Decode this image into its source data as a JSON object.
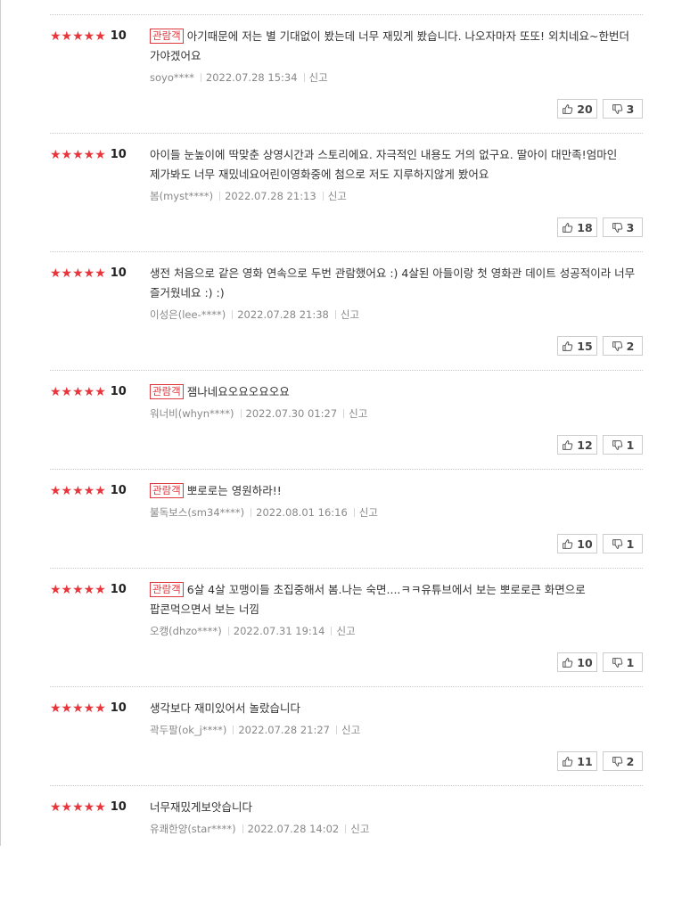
{
  "reviews": [
    {
      "stars": "★★★★★",
      "score": "10",
      "badge": "관람객",
      "text": "아기때문에 저는 별 기대없이 봤는데 너무 재밌게 봤습니다. 나오자마자 또또! 외치네요~한번더 가야겠어요",
      "user": "soyo****",
      "date": "2022.07.28 15:34",
      "report": "신고",
      "likes": "20",
      "dislikes": "3"
    },
    {
      "stars": "★★★★★",
      "score": "10",
      "badge": "",
      "text": "아이들 눈높이에 딱맞춘 상영시간과 스토리에요. 자극적인 내용도 거의 없구요. 딸아이 대만족!엄마인 제가봐도 너무 재밌네요어린이영화중에 첨으로 저도 지루하지않게 봤어요",
      "user": "봄(myst****)",
      "date": "2022.07.28 21:13",
      "report": "신고",
      "likes": "18",
      "dislikes": "3"
    },
    {
      "stars": "★★★★★",
      "score": "10",
      "badge": "",
      "text": "생전 처음으로 같은 영화 연속으로 두번 관람했어요 :) 4살된 아들이랑 첫 영화관 데이트 성공적이라 너무 즐거웠네요 :) :)",
      "user": "이성은(lee-****)",
      "date": "2022.07.28 21:38",
      "report": "신고",
      "likes": "15",
      "dislikes": "2"
    },
    {
      "stars": "★★★★★",
      "score": "10",
      "badge": "관람객",
      "text": "잼나네요오요오요오요",
      "user": "워너비(whyn****)",
      "date": "2022.07.30 01:27",
      "report": "신고",
      "likes": "12",
      "dislikes": "1"
    },
    {
      "stars": "★★★★★",
      "score": "10",
      "badge": "관람객",
      "text": "뽀로로는 영원하라!!",
      "user": "불독보스(sm34****)",
      "date": "2022.08.01 16:16",
      "report": "신고",
      "likes": "10",
      "dislikes": "1"
    },
    {
      "stars": "★★★★★",
      "score": "10",
      "badge": "관람객",
      "text": "6살 4살 꼬맹이들 초집중해서 봄.나는 숙면....ㅋㅋ유튜브에서 보는 뽀로로큰 화면으로 팝콘먹으면서 보는 너낌",
      "user": "오캥(dhzo****)",
      "date": "2022.07.31 19:14",
      "report": "신고",
      "likes": "10",
      "dislikes": "1"
    },
    {
      "stars": "★★★★★",
      "score": "10",
      "badge": "",
      "text": "생각보다 재미있어서 놀랐습니다",
      "user": "곽두팔(ok_j****)",
      "date": "2022.07.28 21:27",
      "report": "신고",
      "likes": "11",
      "dislikes": "2"
    },
    {
      "stars": "★★★★★",
      "score": "10",
      "badge": "",
      "text": "너무재밌게보앗습니다",
      "user": "유쾌한양(star****)",
      "date": "2022.07.28 14:02",
      "report": "신고",
      "likes": "",
      "dislikes": ""
    }
  ],
  "icons": {
    "like": "thumbs-up-icon",
    "dislike": "thumbs-down-icon"
  }
}
